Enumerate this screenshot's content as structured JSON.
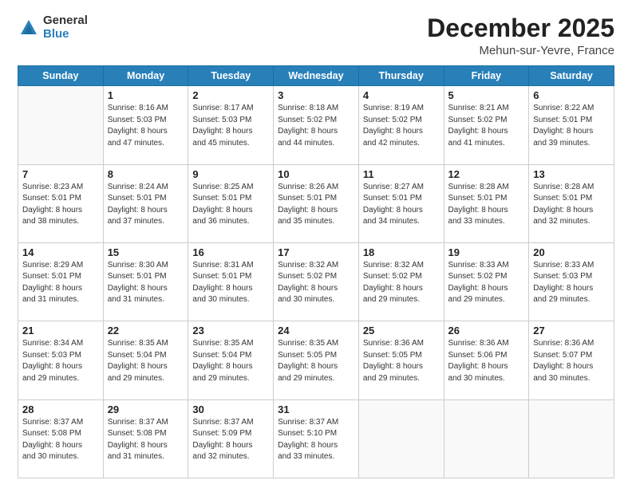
{
  "logo": {
    "general": "General",
    "blue": "Blue"
  },
  "header": {
    "month_year": "December 2025",
    "location": "Mehun-sur-Yevre, France"
  },
  "weekdays": [
    "Sunday",
    "Monday",
    "Tuesday",
    "Wednesday",
    "Thursday",
    "Friday",
    "Saturday"
  ],
  "weeks": [
    [
      {
        "day": "",
        "info": ""
      },
      {
        "day": "1",
        "info": "Sunrise: 8:16 AM\nSunset: 5:03 PM\nDaylight: 8 hours\nand 47 minutes."
      },
      {
        "day": "2",
        "info": "Sunrise: 8:17 AM\nSunset: 5:03 PM\nDaylight: 8 hours\nand 45 minutes."
      },
      {
        "day": "3",
        "info": "Sunrise: 8:18 AM\nSunset: 5:02 PM\nDaylight: 8 hours\nand 44 minutes."
      },
      {
        "day": "4",
        "info": "Sunrise: 8:19 AM\nSunset: 5:02 PM\nDaylight: 8 hours\nand 42 minutes."
      },
      {
        "day": "5",
        "info": "Sunrise: 8:21 AM\nSunset: 5:02 PM\nDaylight: 8 hours\nand 41 minutes."
      },
      {
        "day": "6",
        "info": "Sunrise: 8:22 AM\nSunset: 5:01 PM\nDaylight: 8 hours\nand 39 minutes."
      }
    ],
    [
      {
        "day": "7",
        "info": "Sunrise: 8:23 AM\nSunset: 5:01 PM\nDaylight: 8 hours\nand 38 minutes."
      },
      {
        "day": "8",
        "info": "Sunrise: 8:24 AM\nSunset: 5:01 PM\nDaylight: 8 hours\nand 37 minutes."
      },
      {
        "day": "9",
        "info": "Sunrise: 8:25 AM\nSunset: 5:01 PM\nDaylight: 8 hours\nand 36 minutes."
      },
      {
        "day": "10",
        "info": "Sunrise: 8:26 AM\nSunset: 5:01 PM\nDaylight: 8 hours\nand 35 minutes."
      },
      {
        "day": "11",
        "info": "Sunrise: 8:27 AM\nSunset: 5:01 PM\nDaylight: 8 hours\nand 34 minutes."
      },
      {
        "day": "12",
        "info": "Sunrise: 8:28 AM\nSunset: 5:01 PM\nDaylight: 8 hours\nand 33 minutes."
      },
      {
        "day": "13",
        "info": "Sunrise: 8:28 AM\nSunset: 5:01 PM\nDaylight: 8 hours\nand 32 minutes."
      }
    ],
    [
      {
        "day": "14",
        "info": "Sunrise: 8:29 AM\nSunset: 5:01 PM\nDaylight: 8 hours\nand 31 minutes."
      },
      {
        "day": "15",
        "info": "Sunrise: 8:30 AM\nSunset: 5:01 PM\nDaylight: 8 hours\nand 31 minutes."
      },
      {
        "day": "16",
        "info": "Sunrise: 8:31 AM\nSunset: 5:01 PM\nDaylight: 8 hours\nand 30 minutes."
      },
      {
        "day": "17",
        "info": "Sunrise: 8:32 AM\nSunset: 5:02 PM\nDaylight: 8 hours\nand 30 minutes."
      },
      {
        "day": "18",
        "info": "Sunrise: 8:32 AM\nSunset: 5:02 PM\nDaylight: 8 hours\nand 29 minutes."
      },
      {
        "day": "19",
        "info": "Sunrise: 8:33 AM\nSunset: 5:02 PM\nDaylight: 8 hours\nand 29 minutes."
      },
      {
        "day": "20",
        "info": "Sunrise: 8:33 AM\nSunset: 5:03 PM\nDaylight: 8 hours\nand 29 minutes."
      }
    ],
    [
      {
        "day": "21",
        "info": "Sunrise: 8:34 AM\nSunset: 5:03 PM\nDaylight: 8 hours\nand 29 minutes."
      },
      {
        "day": "22",
        "info": "Sunrise: 8:35 AM\nSunset: 5:04 PM\nDaylight: 8 hours\nand 29 minutes."
      },
      {
        "day": "23",
        "info": "Sunrise: 8:35 AM\nSunset: 5:04 PM\nDaylight: 8 hours\nand 29 minutes."
      },
      {
        "day": "24",
        "info": "Sunrise: 8:35 AM\nSunset: 5:05 PM\nDaylight: 8 hours\nand 29 minutes."
      },
      {
        "day": "25",
        "info": "Sunrise: 8:36 AM\nSunset: 5:05 PM\nDaylight: 8 hours\nand 29 minutes."
      },
      {
        "day": "26",
        "info": "Sunrise: 8:36 AM\nSunset: 5:06 PM\nDaylight: 8 hours\nand 30 minutes."
      },
      {
        "day": "27",
        "info": "Sunrise: 8:36 AM\nSunset: 5:07 PM\nDaylight: 8 hours\nand 30 minutes."
      }
    ],
    [
      {
        "day": "28",
        "info": "Sunrise: 8:37 AM\nSunset: 5:08 PM\nDaylight: 8 hours\nand 30 minutes."
      },
      {
        "day": "29",
        "info": "Sunrise: 8:37 AM\nSunset: 5:08 PM\nDaylight: 8 hours\nand 31 minutes."
      },
      {
        "day": "30",
        "info": "Sunrise: 8:37 AM\nSunset: 5:09 PM\nDaylight: 8 hours\nand 32 minutes."
      },
      {
        "day": "31",
        "info": "Sunrise: 8:37 AM\nSunset: 5:10 PM\nDaylight: 8 hours\nand 33 minutes."
      },
      {
        "day": "",
        "info": ""
      },
      {
        "day": "",
        "info": ""
      },
      {
        "day": "",
        "info": ""
      }
    ]
  ]
}
